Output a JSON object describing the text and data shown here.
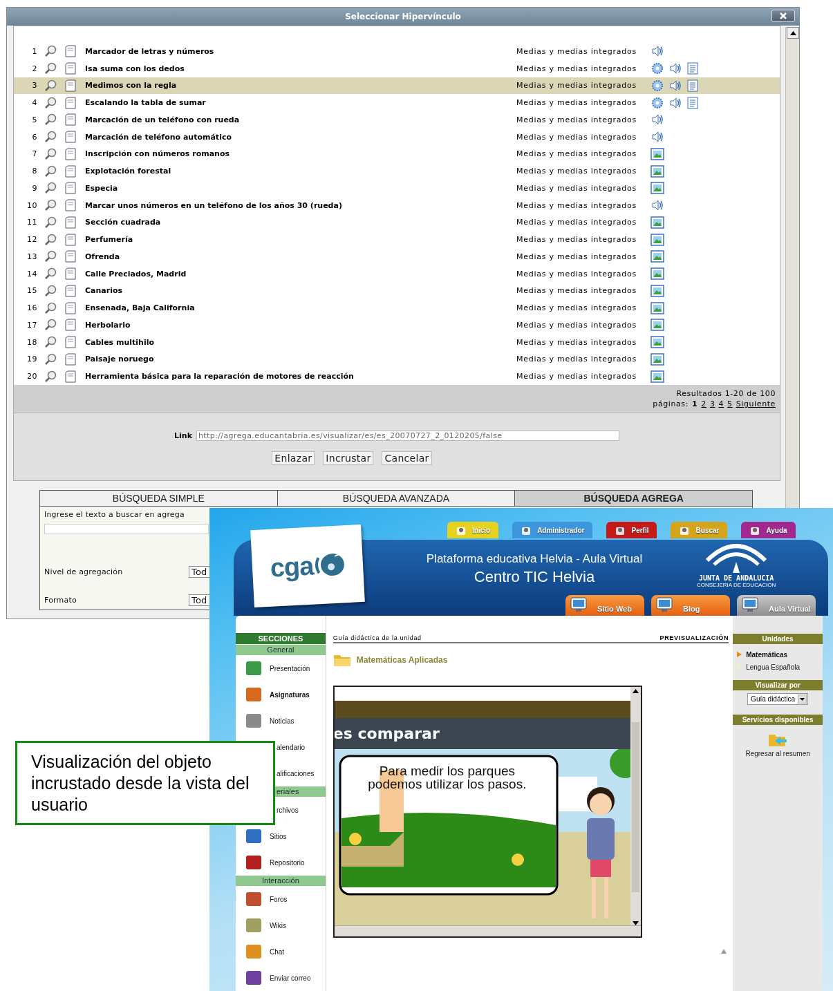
{
  "dialog": {
    "title": "Seleccionar Hipervínculo",
    "rows": [
      {
        "number": "1",
        "title": "Marcador de letras y números",
        "type": "Medias y medias integrados",
        "media": [
          {
            "kind": "audio"
          }
        ],
        "selected": false
      },
      {
        "number": "2",
        "title": "Isa suma con los dedos",
        "type": "Medias y medias integrados",
        "media": [
          {
            "kind": "gear"
          },
          {
            "kind": "audio"
          },
          {
            "kind": "text"
          }
        ],
        "selected": false
      },
      {
        "number": "3",
        "title": "Medimos con la regla",
        "type": "Medias y medias integrados",
        "media": [
          {
            "kind": "gear"
          },
          {
            "kind": "audio"
          },
          {
            "kind": "text"
          }
        ],
        "selected": true
      },
      {
        "number": "4",
        "title": "Escalando la tabla de sumar",
        "type": "Medias y medias integrados",
        "media": [
          {
            "kind": "gear"
          },
          {
            "kind": "audio"
          },
          {
            "kind": "text"
          }
        ],
        "selected": false
      },
      {
        "number": "5",
        "title": "Marcación de un teléfono con rueda",
        "type": "Medias y medias integrados",
        "media": [
          {
            "kind": "audio"
          }
        ],
        "selected": false
      },
      {
        "number": "6",
        "title": "Marcación de teléfono automático",
        "type": "Medias y medias integrados",
        "media": [
          {
            "kind": "audio"
          }
        ],
        "selected": false
      },
      {
        "number": "7",
        "title": "Inscripción con números romanos",
        "type": "Medias y medias integrados",
        "media": [
          {
            "kind": "image"
          }
        ],
        "selected": false
      },
      {
        "number": "8",
        "title": "Explotación forestal",
        "type": "Medias y medias integrados",
        "media": [
          {
            "kind": "image"
          }
        ],
        "selected": false
      },
      {
        "number": "9",
        "title": "Especia",
        "type": "Medias y medias integrados",
        "media": [
          {
            "kind": "image"
          }
        ],
        "selected": false
      },
      {
        "number": "10",
        "title": "Marcar unos números en un teléfono de los años 30 (rueda)",
        "type": "Medias y medias integrados",
        "media": [
          {
            "kind": "audio"
          }
        ],
        "selected": false
      },
      {
        "number": "11",
        "title": "Sección cuadrada",
        "type": "Medias y medias integrados",
        "media": [
          {
            "kind": "image"
          }
        ],
        "selected": false
      },
      {
        "number": "12",
        "title": "Perfumería",
        "type": "Medias y medias integrados",
        "media": [
          {
            "kind": "image"
          }
        ],
        "selected": false
      },
      {
        "number": "13",
        "title": "Ofrenda",
        "type": "Medias y medias integrados",
        "media": [
          {
            "kind": "image"
          }
        ],
        "selected": false
      },
      {
        "number": "14",
        "title": "Calle Preciados, Madrid",
        "type": "Medias y medias integrados",
        "media": [
          {
            "kind": "image"
          }
        ],
        "selected": false
      },
      {
        "number": "15",
        "title": "Canarios",
        "type": "Medias y medias integrados",
        "media": [
          {
            "kind": "image"
          }
        ],
        "selected": false
      },
      {
        "number": "16",
        "title": "Ensenada, Baja California",
        "type": "Medias y medias integrados",
        "media": [
          {
            "kind": "image"
          }
        ],
        "selected": false
      },
      {
        "number": "17",
        "title": "Herbolario",
        "type": "Medias y medias integrados",
        "media": [
          {
            "kind": "image"
          }
        ],
        "selected": false
      },
      {
        "number": "18",
        "title": "Cables multihilo",
        "type": "Medias y medias integrados",
        "media": [
          {
            "kind": "image"
          }
        ],
        "selected": false
      },
      {
        "number": "19",
        "title": "Paisaje noruego",
        "type": "Medias y medias integrados",
        "media": [
          {
            "kind": "image"
          }
        ],
        "selected": false
      },
      {
        "number": "20",
        "title": "Herramienta básica para la reparación de motores de reacción",
        "type": "Medias y medias integrados",
        "media": [
          {
            "kind": "image"
          }
        ],
        "selected": false
      }
    ],
    "results": "Resultados 1-20 de 100",
    "pages_label": "páginas:",
    "pages": [
      {
        "label": "1",
        "selected": true
      },
      {
        "label": "2",
        "selected": false
      },
      {
        "label": "3",
        "selected": false
      },
      {
        "label": "4",
        "selected": false
      },
      {
        "label": "5",
        "selected": false
      }
    ],
    "next": "Siguiente",
    "link_label": "Link",
    "link_value": "http://agrega.educantabria.es/visualizar/es/es_20070727_2_0120205/false",
    "buttons": [
      "Enlazar",
      "Incrustar",
      "Cancelar"
    ],
    "search_tabs": [
      {
        "label": "BÚSQUEDA SIMPLE",
        "selected": false
      },
      {
        "label": "BÚSQUEDA AVANZADA",
        "selected": false
      },
      {
        "label": "BÚSQUEDA AGREGA",
        "selected": true
      }
    ],
    "search_prompt": "Ingrese el texto a buscar en agrega",
    "search_fields": [
      {
        "label": "Nivel de agregación",
        "value": "Tod"
      },
      {
        "label": "Formato",
        "value": "Tod"
      }
    ]
  },
  "helvia": {
    "top_tabs": [
      {
        "label": "Inicio",
        "color": "#e6d21e"
      },
      {
        "label": "Administrador",
        "color": "#3d95dc"
      },
      {
        "label": "Perfil",
        "color": "#c41a1a"
      },
      {
        "label": "Buscar",
        "color": "#d4a41a"
      },
      {
        "label": "Ayuda",
        "color": "#a2288e"
      }
    ],
    "logo": "cga",
    "title": "Plataforma educativa Helvia - Aula Virtual",
    "subtitle": "Centro TIC Helvia",
    "org": "JUNTA DE ANDALUCIA",
    "org_sub": "CONSEJERIA DE EDUCACION",
    "site_tabs": [
      {
        "label": "Sitio Web",
        "selected": false
      },
      {
        "label": "Blog",
        "selected": false
      },
      {
        "label": "Aula Virtual",
        "selected": true
      }
    ],
    "sections_title": "SECCIONES",
    "sections": [
      {
        "kind": "header",
        "label": "General"
      },
      {
        "kind": "item",
        "label": "Presentación",
        "bold": false
      },
      {
        "kind": "item",
        "label": "Asignaturas",
        "bold": true
      },
      {
        "kind": "item",
        "label": "Noticias",
        "bold": false
      },
      {
        "kind": "cut",
        "label": "alendario",
        "bold": false
      },
      {
        "kind": "cut",
        "label": "alificaciones",
        "bold": false
      },
      {
        "kind": "cut_header",
        "label": "eriales"
      },
      {
        "kind": "cut",
        "label": "rchivos",
        "bold": false
      },
      {
        "kind": "item",
        "label": "Sitios",
        "bold": false
      },
      {
        "kind": "item",
        "label": "Repositorio",
        "bold": false
      },
      {
        "kind": "header",
        "label": "Interacción"
      },
      {
        "kind": "item",
        "label": "Foros",
        "bold": false
      },
      {
        "kind": "item",
        "label": "Wikis",
        "bold": false
      },
      {
        "kind": "item",
        "label": "Chat",
        "bold": false
      },
      {
        "kind": "item",
        "label": "Enviar correo",
        "bold": false
      }
    ],
    "breadcrumb": "Guía didáctica de la unidad",
    "mode": "PREVISUALIZACIÓN",
    "unit_title": "Matemáticas Aplicadas",
    "embed_heading": "es comparar",
    "embed_speech": "Para medir los parques podemos utilizar los pasos.",
    "units_title": "Unidades",
    "units": [
      {
        "label": "Matemáticas",
        "selected": true
      },
      {
        "label": "Lengua Española",
        "selected": false
      }
    ],
    "view_title": "Visualizar por",
    "view_value": "Guía didáctica",
    "services_title": "Servicios disponibles",
    "back_label": "Regresar al resumen"
  },
  "callout": "Visualización del objeto incrustado desde la vista del usuario"
}
